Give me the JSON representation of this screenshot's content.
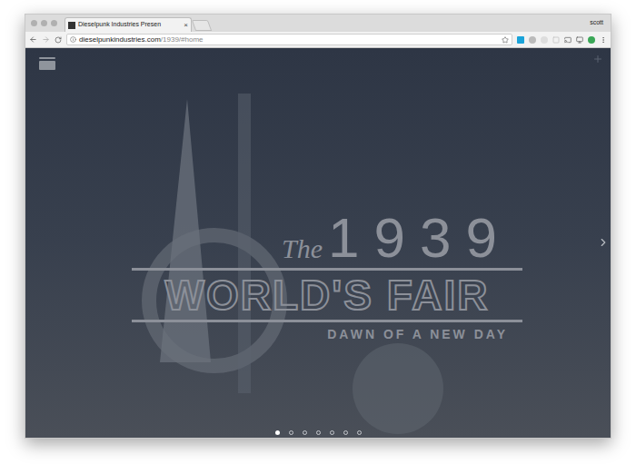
{
  "browser": {
    "tab": {
      "title": "Dieselpunk Industries Presen",
      "close": "×"
    },
    "profile": "scott",
    "url_host": "dieselpunkindustries.com",
    "url_path": "/1939/#home"
  },
  "page": {
    "logo": {
      "the": "The",
      "year": "1939",
      "title": "WORLD'S FAIR",
      "tagline": "DAWN OF A NEW DAY"
    },
    "slides": [
      {
        "selected": true
      },
      {
        "selected": false
      },
      {
        "selected": false
      },
      {
        "selected": false
      },
      {
        "selected": false
      },
      {
        "selected": false
      },
      {
        "selected": false
      }
    ]
  }
}
